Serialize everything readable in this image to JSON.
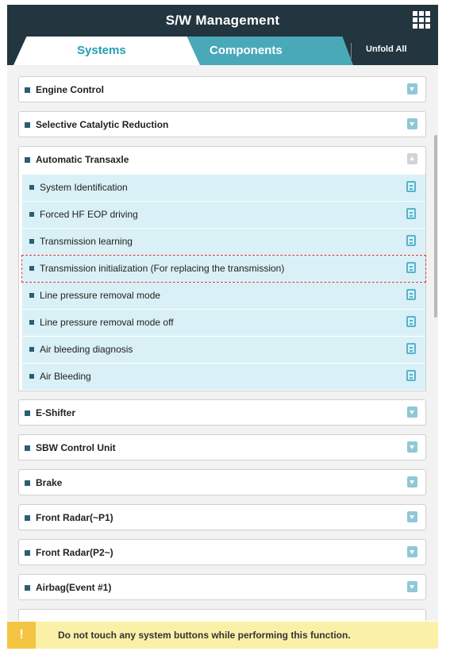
{
  "header": {
    "title": "S/W Management",
    "menu_icon": "grid-menu-icon"
  },
  "tabs": [
    {
      "label": "Systems",
      "active": true
    },
    {
      "label": "Components",
      "active": false
    }
  ],
  "unfold_label": "Unfold All",
  "systems": [
    {
      "label": "Engine Control"
    },
    {
      "label": "Selective Catalytic Reduction"
    },
    {
      "label": "Automatic Transaxle",
      "expanded": true,
      "functions": [
        {
          "label": "System Identification"
        },
        {
          "label": "Forced HF EOP driving"
        },
        {
          "label": "Transmission learning"
        },
        {
          "label": "Transmission initialization (For replacing the transmission)",
          "selected": true
        },
        {
          "label": "Line pressure removal mode"
        },
        {
          "label": "Line pressure removal mode off"
        },
        {
          "label": "Air bleeding diagnosis"
        },
        {
          "label": "Air Bleeding"
        }
      ]
    },
    {
      "label": "E-Shifter"
    },
    {
      "label": "SBW Control Unit"
    },
    {
      "label": "Brake"
    },
    {
      "label": "Front Radar(~P1)"
    },
    {
      "label": "Front Radar(P2~)"
    },
    {
      "label": "Airbag(Event #1)"
    }
  ],
  "footer": {
    "warning_symbol": "!",
    "message": "Do not touch any system buttons while performing this function."
  },
  "colors": {
    "header": "#23353f",
    "tab_active_text": "#23a0b6",
    "tab_inactive": "#4aa9b9",
    "sub_row_bg": "#d9f0f6",
    "warning_bg": "#fbf0a8",
    "warning_icon": "#f4c542",
    "selection_outline": "#d93a3a"
  }
}
